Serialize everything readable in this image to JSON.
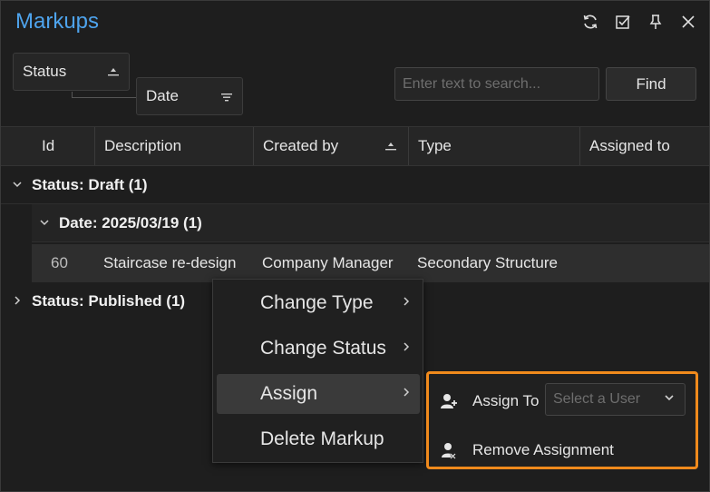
{
  "window": {
    "title": "Markups"
  },
  "title_icons": [
    "refresh-icon",
    "checkbox-icon",
    "pin-icon",
    "close-icon"
  ],
  "grouping": {
    "chips": [
      {
        "label": "Status",
        "sort": "ascending"
      },
      {
        "label": "Date",
        "sort": "filter"
      }
    ]
  },
  "search": {
    "placeholder": "Enter text to search...",
    "value": "",
    "button_label": "Find"
  },
  "grid": {
    "columns": [
      "Id",
      "Description",
      "Created by",
      "Type",
      "Assigned to"
    ],
    "sorted_column": "Created by",
    "groups": [
      {
        "label": "Status: Draft (1)",
        "expanded": true
      },
      {
        "label": "Date: 2025/03/19 (1)",
        "expanded": true
      },
      {
        "label": "Status: Published (1)",
        "expanded": false
      }
    ],
    "rows": [
      {
        "id": "60",
        "description": "Staircase re-design",
        "created_by": "Company Manager",
        "type": "Secondary Structure",
        "assigned_to": ""
      }
    ]
  },
  "context_menu": {
    "items": [
      {
        "label": "Change Type",
        "has_submenu": true
      },
      {
        "label": "Change Status",
        "has_submenu": true
      },
      {
        "label": "Assign",
        "has_submenu": true,
        "active": true
      },
      {
        "label": "Delete Markup",
        "has_submenu": false
      }
    ]
  },
  "assign_submenu": {
    "assign_to_label": "Assign To",
    "select_placeholder": "Select a User",
    "remove_label": "Remove Assignment",
    "highlight_color": "#f08a1c"
  },
  "colors": {
    "accent": "#4ea3ec",
    "background": "#1e1e1e"
  }
}
